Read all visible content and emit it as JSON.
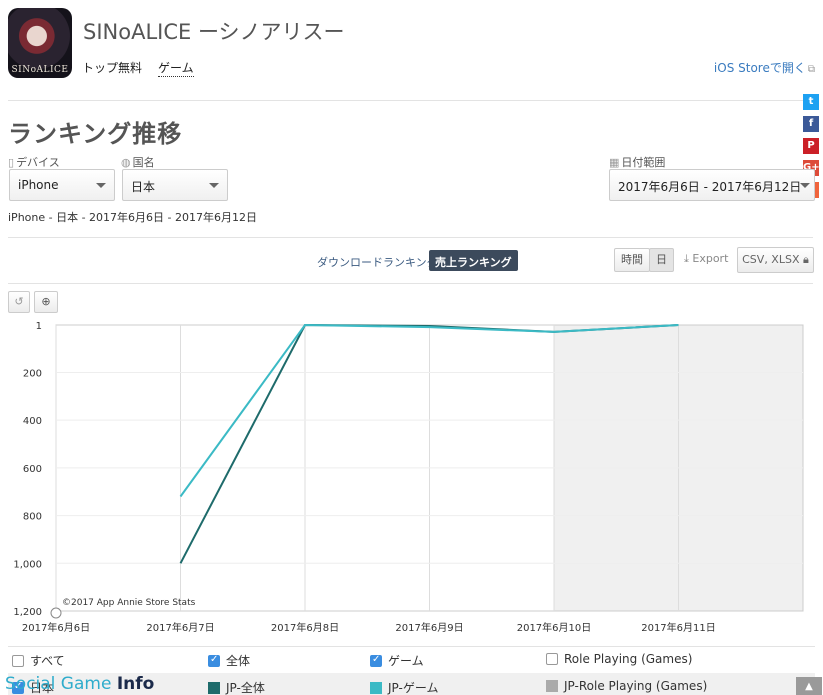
{
  "app": {
    "title": "SINoALICE ーシノアリスー",
    "icon_text": "SINoALICE",
    "ranking_label": "トップ無料",
    "genre_label": "ゲーム",
    "ios_store_link": "iOS Storeで開く"
  },
  "social": [
    {
      "name": "twitter-icon",
      "glyph": "t",
      "color": "#1da1f2"
    },
    {
      "name": "facebook-icon",
      "glyph": "f",
      "color": "#3b5998"
    },
    {
      "name": "pinterest-icon",
      "glyph": "P",
      "color": "#cb2027"
    },
    {
      "name": "googleplus-icon",
      "glyph": "G+",
      "color": "#dd4b39"
    },
    {
      "name": "add-share-icon",
      "glyph": "+",
      "color": "#f0643c"
    }
  ],
  "section": {
    "title": "ランキング推移"
  },
  "filters": {
    "device_label": "デバイス",
    "device_value": "iPhone",
    "country_label": "国名",
    "country_value": "日本",
    "date_label": "日付範囲",
    "date_value": "2017年6月6日 - 2017年6月12日"
  },
  "summary": "iPhone - 日本 - 2017年6月6日 - 2017年6月12日",
  "tabs": {
    "download": "ダウンロードランキング",
    "sales": "売上ランキング"
  },
  "controls": {
    "hourly": "時間",
    "daily": "日",
    "export": "Export",
    "csv": "CSV, XLSX"
  },
  "chart_data": {
    "type": "line",
    "x": [
      "2017年6月6日",
      "2017年6月7日",
      "2017年6月8日",
      "2017年6月9日",
      "2017年6月10日",
      "2017年6月11日"
    ],
    "y_ticks": [
      "1",
      "200",
      "400",
      "600",
      "800",
      "1,000",
      "1,200"
    ],
    "ylim": [
      1,
      1200
    ],
    "y_inverted": true,
    "shaded_from": "2017年6月10日",
    "credit": "©2017 App Annie Store Stats",
    "series": [
      {
        "name": "JP-全体",
        "color": "#1e6b6b",
        "values": [
          null,
          1000,
          1,
          5,
          30,
          1
        ]
      },
      {
        "name": "JP-ゲーム",
        "color": "#3bbac5",
        "values": [
          null,
          720,
          1,
          10,
          30,
          1
        ]
      }
    ]
  },
  "legend": {
    "all_label": "すべて",
    "total_label": "全体",
    "game_label": "ゲーム",
    "rpg_label": "Role Playing (Games)",
    "country_label": "日本",
    "series": [
      {
        "label": "JP-全体",
        "color": "#1e6b6b"
      },
      {
        "label": "JP-ゲーム",
        "color": "#3bbac5"
      },
      {
        "label": "JP-Role Playing (Games)",
        "color": "#aaaaaa"
      }
    ]
  },
  "watermark": {
    "part1": "Social Game ",
    "part2": "Info"
  }
}
